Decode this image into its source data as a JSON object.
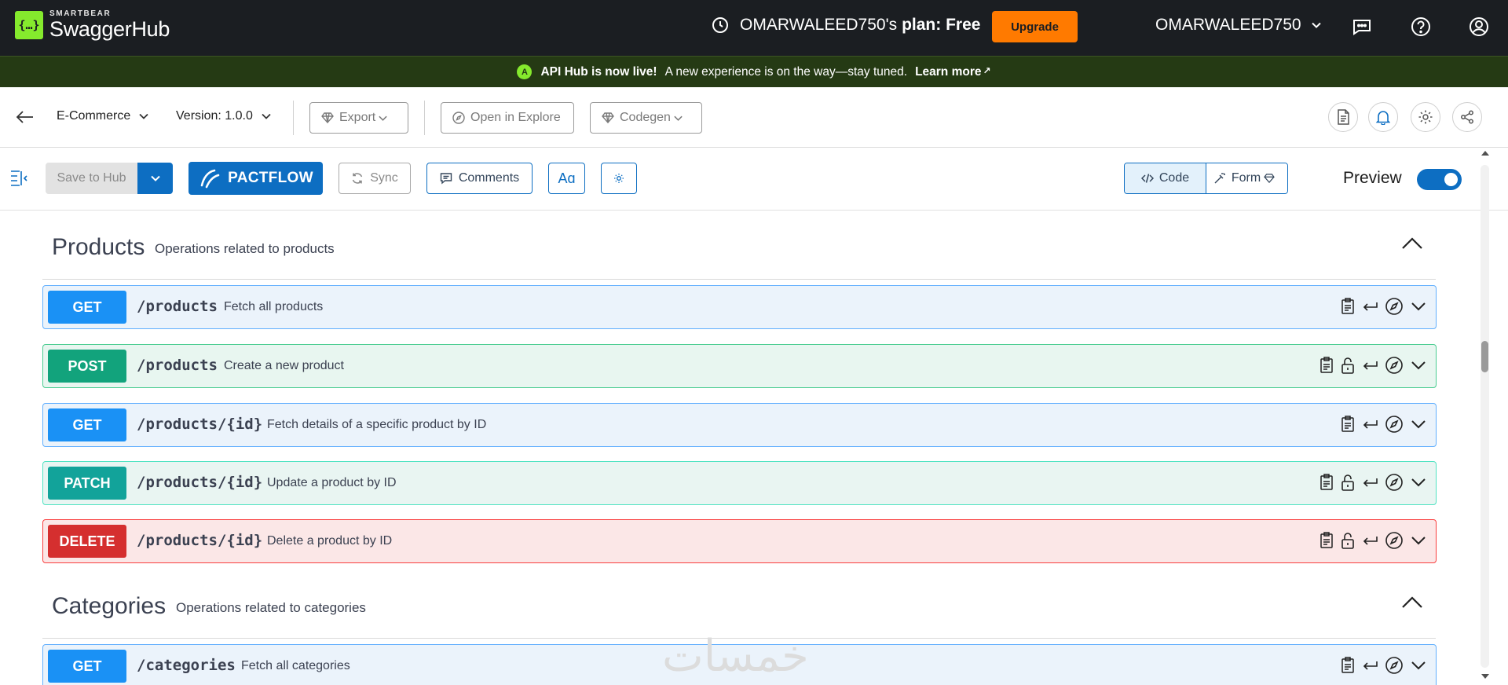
{
  "topbar": {
    "brand_sub": "SMARTBEAR",
    "brand_main": "SwaggerHub",
    "plan_owner": "OMARWALEED750's",
    "plan_label": "plan: Free",
    "upgrade_label": "Upgrade",
    "username": "OMARWALEED750",
    "icons": [
      "clock-icon",
      "chat-icon",
      "help-icon",
      "account-icon"
    ]
  },
  "banner": {
    "badge": "A",
    "headline": "API Hub is now live!",
    "message": "A new experience is on the way—stay tuned.",
    "link_label": "Learn more",
    "link_arrow": "↗"
  },
  "apibar": {
    "api_name": "E-Commerce",
    "version": "Version: 1.0.0",
    "export_label": "Export",
    "explore_label": "Open in Explore",
    "codegen_label": "Codegen",
    "icons": [
      "document-icon",
      "bell-icon",
      "gear-icon",
      "share-icon"
    ]
  },
  "editor_toolbar": {
    "save_label": "Save to Hub",
    "pactflow_label": "PACTFLOW",
    "sync_label": "Sync",
    "comments_label": "Comments",
    "font_label": "Aɑ",
    "code_label": "Code",
    "form_label": "Form",
    "preview_label": "Preview",
    "preview_enabled": true
  },
  "sections": [
    {
      "title": "Products",
      "description": "Operations related to products",
      "expanded": true,
      "operations": [
        {
          "method": "GET",
          "path": "/products",
          "summary": "Fetch all products",
          "locked": false
        },
        {
          "method": "POST",
          "path": "/products",
          "summary": "Create a new product",
          "locked": true
        },
        {
          "method": "GET",
          "path": "/products/{id}",
          "summary": "Fetch details of a specific product by ID",
          "locked": false
        },
        {
          "method": "PATCH",
          "path": "/products/{id}",
          "summary": "Update a product by ID",
          "locked": true
        },
        {
          "method": "DELETE",
          "path": "/products/{id}",
          "summary": "Delete a product by ID",
          "locked": true
        }
      ]
    },
    {
      "title": "Categories",
      "description": "Operations related to categories",
      "expanded": true,
      "operations": [
        {
          "method": "GET",
          "path": "/categories",
          "summary": "Fetch all categories",
          "locked": false
        }
      ]
    }
  ],
  "colors": {
    "topbar_bg": "#1b1e22",
    "banner_bg": "#253a14",
    "brand_green": "#85ea2d",
    "upgrade_orange": "#ff7a00",
    "primary_blue": "#0d6ec2",
    "get": "#1a91f5",
    "post": "#12a37c",
    "patch": "#12a39a",
    "delete": "#d52f2f"
  },
  "watermark": "خمسات"
}
